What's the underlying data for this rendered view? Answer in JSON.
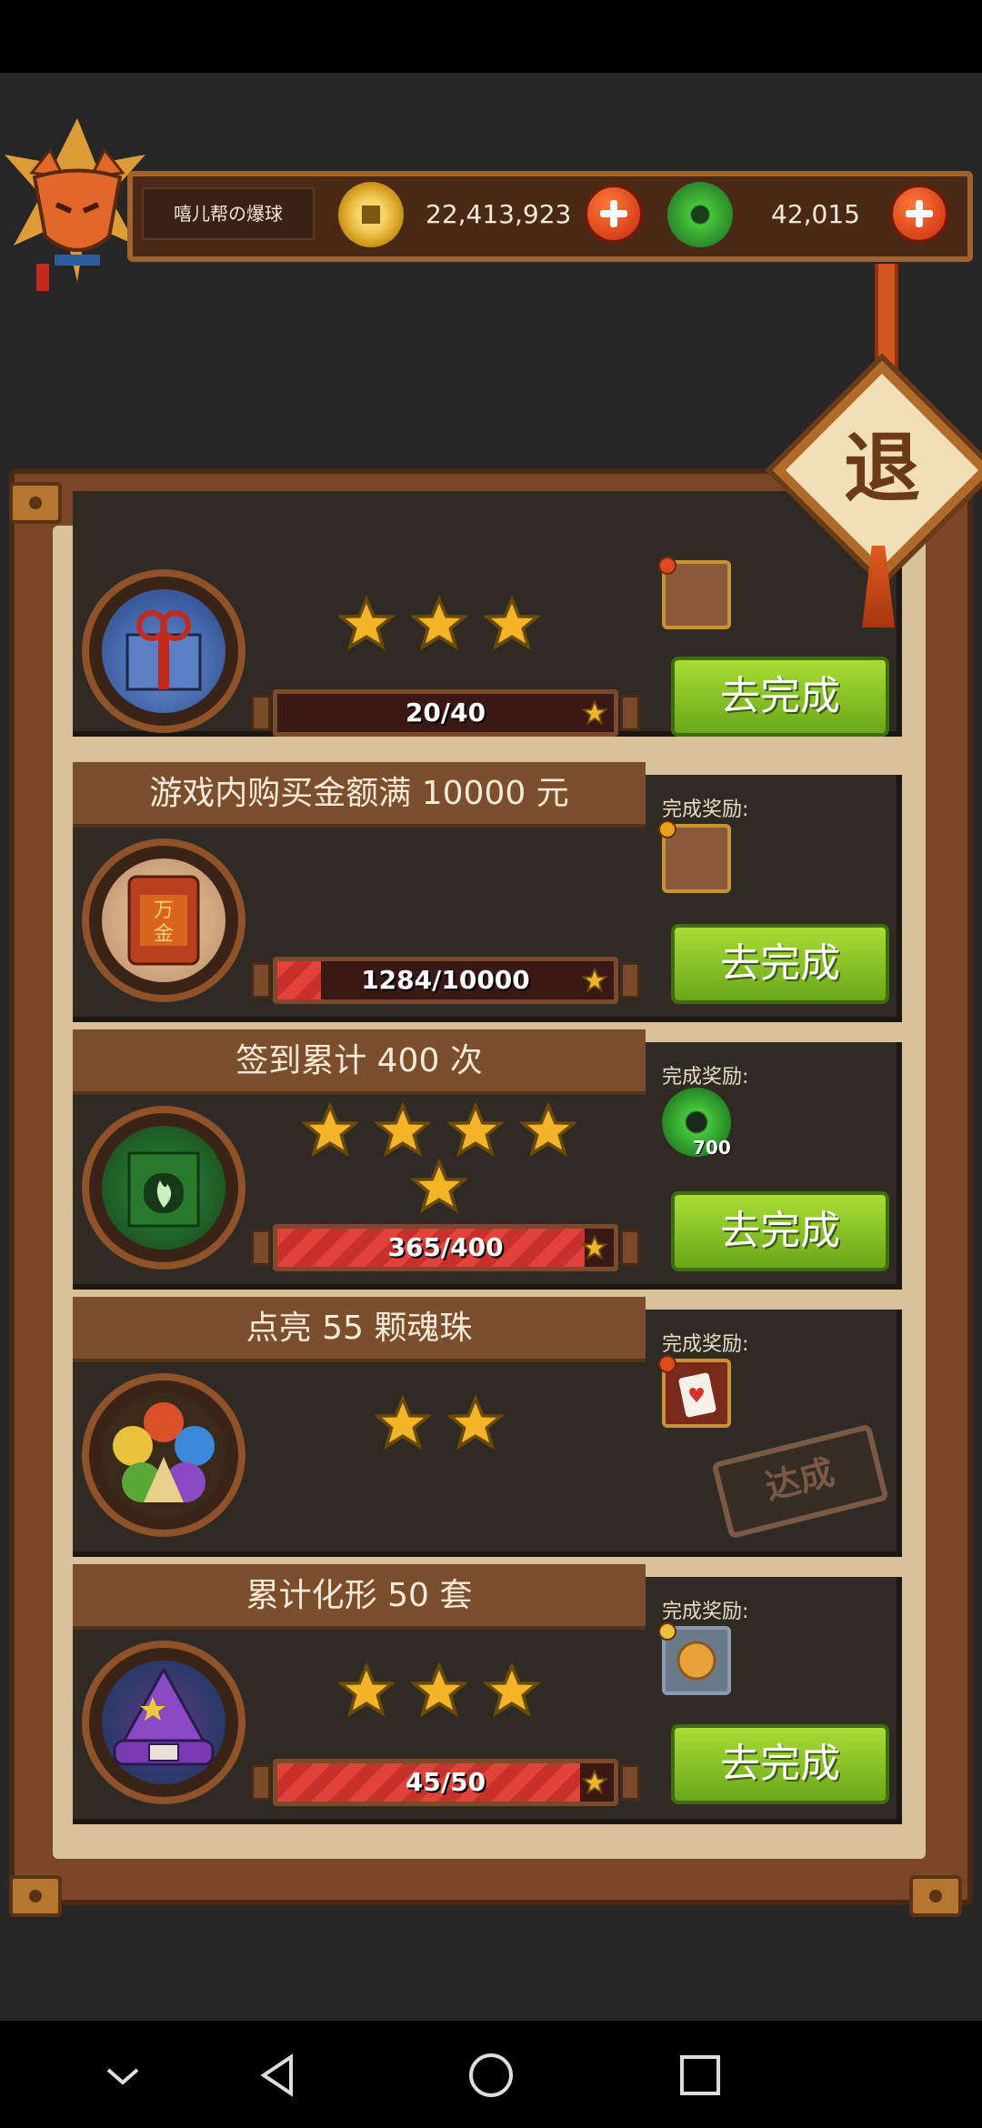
{
  "header": {
    "player_name": "嘻儿帮の爆球",
    "coins": "22,413,923",
    "gems": "42,015"
  },
  "exit_label": "退",
  "quests": [
    {
      "title": "",
      "progress_text": "20/40",
      "progress": 0.5,
      "stars": 3,
      "reward_label": "",
      "button": "去完成"
    },
    {
      "title": "游戏内购买金额满 10000 元",
      "progress_text": "1284/10000",
      "progress": 0.1284,
      "stars": 0,
      "reward_label": "完成奖励:",
      "button": "去完成",
      "icon_text": "万\n金"
    },
    {
      "title": "签到累计 400 次",
      "progress_text": "365/400",
      "progress": 0.9125,
      "stars": 5,
      "reward_label": "完成奖励:",
      "reward_qty": "700",
      "button": "去完成"
    },
    {
      "title": "点亮 55 颗魂珠",
      "progress_text": "",
      "progress": 1,
      "stars": 2,
      "reward_label": "完成奖励:",
      "button": "",
      "stamp": "达成"
    },
    {
      "title": "累计化形 50 套",
      "progress_text": "45/50",
      "progress": 0.9,
      "stars": 3,
      "reward_label": "完成奖励:",
      "button": "去完成"
    }
  ],
  "colors": {
    "button_green": "#8cc524",
    "frame_brown": "#7b4626",
    "panel_tan": "#d9c29a"
  }
}
